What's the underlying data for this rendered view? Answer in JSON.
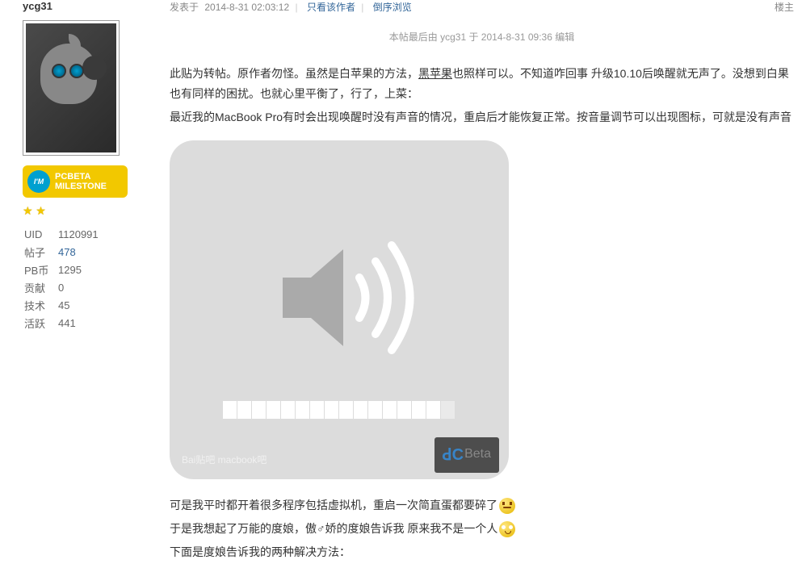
{
  "sidebar": {
    "username": "ycg31",
    "badge_line1": "PCBETA",
    "badge_line2": "MILESTONE",
    "badge_bubble": "I'M",
    "stats": [
      {
        "label": "UID",
        "value": "1120991",
        "link": false
      },
      {
        "label": "帖子",
        "value": "478",
        "link": true
      },
      {
        "label": "PB币",
        "value": "1295",
        "link": false
      },
      {
        "label": "贡献",
        "value": "0",
        "link": false
      },
      {
        "label": "技术",
        "value": "45",
        "link": false
      },
      {
        "label": "活跃",
        "value": "441",
        "link": false
      }
    ]
  },
  "header": {
    "posted_label": "发表于",
    "posted_time": "2014-8-31 02:03:12",
    "view_author": "只看该作者",
    "reverse_order": "倒序浏览",
    "floor": "楼主"
  },
  "edit_note": "本帖最后由 ycg31 于 2014-8-31 09:36 编辑",
  "content": {
    "p1_a": "此贴为转帖。原作者勿怪。",
    "p1_b": "虽然是白苹果的方法，",
    "p1_underline": "黑苹果",
    "p1_c": "也照样可以。不知道咋回事  升级10.10后唤醒就无声了。没想到白果也有同样的困扰。也就心里平衡了，行了，上菜：",
    "p2": "最近我的MacBook Pro有时会出现唤醒时没有声音的情况，重启后才能恢复正常。按音量调节可以出现图标，可就是没有声音",
    "p3": "可是我平时都开着很多程序包括虚拟机，重启一次简直蛋都要碎了",
    "p4": "于是我想起了万能的度娘，傲♂娇的度娘告诉我 原来我不是一个人",
    "p5": "下面是度娘告诉我的两种解决方法："
  },
  "watermark": {
    "left": "Bai贴吧  macbook吧",
    "right_beta": "Beta"
  }
}
